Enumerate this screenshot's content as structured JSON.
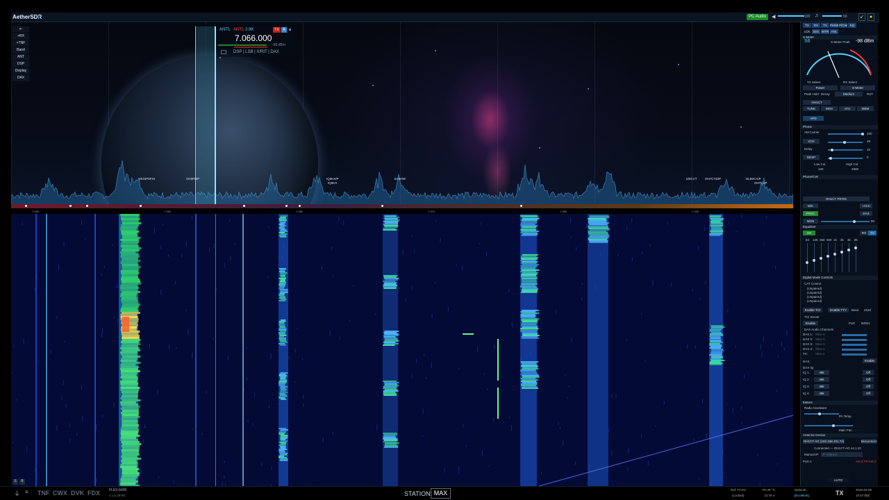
{
  "app": {
    "title": "AetherSDR",
    "slice_label": "Slice A"
  },
  "top": {
    "pc_audio": "PC Audio",
    "vol1": "100",
    "vol2": "50"
  },
  "left_tools": [
    "⇤",
    "+RX",
    "+TNF",
    "Band",
    "ANT",
    "DSP",
    "Display",
    "DAX"
  ],
  "slice": {
    "ant1": "ANT1",
    "ant2": "ANT1",
    "bw": "2.9K",
    "tx": "TX",
    "letter": "A",
    "frequency": "7.066.000",
    "dbm": "-98 dBm",
    "tabs": "DSP  |  LSB  |  X/RIT  |  DAX"
  },
  "spots": [
    {
      "text": "VK/SP6FIH"
    },
    {
      "text": "OH3FB/P"
    },
    {
      "text": "IQ0KX/P"
    },
    {
      "text": "IQ0KX"
    },
    {
      "text": "EA9HW"
    },
    {
      "text": "IZ0CVT"
    },
    {
      "text": "OH7CYD/P"
    },
    {
      "text": "DL8SCA/P"
    },
    {
      "text": "OH7CVP"
    }
  ],
  "scale": [
    "7.040",
    "7.050",
    "7.060",
    "7.070",
    "7.080",
    "7.090",
    "7.100"
  ],
  "right": {
    "tabs": [
      "TX",
      "RX",
      "TX",
      "PHNE",
      "P/CW",
      "EQ"
    ],
    "tabs2": [
      "LCK",
      "DIG",
      "WTR",
      "ANL"
    ],
    "smeter_title": "S-Meter",
    "s_value": "S6",
    "dbm_value": "-98 dBm",
    "smeter_caption": "S-Meter Peak",
    "tx_select": "TX Select",
    "rx_select": "RX Select",
    "power": "Power",
    "smeter": "S-Meter",
    "peak_hold": "Peak Hold",
    "decay": "Decay",
    "medium": "Medium",
    "rst": "RST",
    "callsign_select": "OH1CT",
    "tune": "TUNE",
    "mox": "MOX",
    "atu": "ATU",
    "mem": "MEM",
    "apd": "APD",
    "phone_head": "Phone",
    "am_carrier": "AM Carrier",
    "am_val": "100",
    "vox": "VOX",
    "vox_val": "49",
    "delay": "Delay",
    "delay_val": "16",
    "dexp": "DEXP",
    "dexp_val": "0",
    "lowcut": "Low Cut",
    "highcut": "High Cut",
    "tx_lo": "100",
    "tx_hi": "2900",
    "phonecw_head": "Phone/CW",
    "profile": "OH1CT PR781",
    "mic": "MIC",
    "acc": "+ACC",
    "proc": "PROC",
    "dax": "DAX",
    "mon": "MON",
    "mon_val": "80",
    "eq_head": "Equalizer",
    "eq_on": "ON",
    "eq_rx": "RX",
    "eq_tx": "TX",
    "eq_freqs": [
      "63",
      "125",
      "250",
      "500",
      "1k",
      "2k",
      "4k",
      "8k"
    ],
    "digital_head": "Digital Mode Controls",
    "cat_control": "CAT Control",
    "cat_rows": [
      "(Unpaired)",
      "(Unpaired)",
      "(Unpaired)",
      "(Unpaired)"
    ],
    "enable_tci": "Enable TCI",
    "enable_tty": "Enable TTY",
    "base": "Base:",
    "base_val": "4532",
    "tci_server": "TCI Server",
    "enable": "Enable",
    "port": "Port:",
    "port_val": "50001",
    "dax_audio": "DAX Audio Channels",
    "dax_rows": [
      "DAX 1:",
      "DAX 2:",
      "DAX 3:",
      "DAX 4:",
      "TX:"
    ],
    "dax_slice": "Slice A",
    "dax_label": "DAX:",
    "dax_enable": "Enable",
    "daxiq_head": "DAX IQ",
    "iq_rows": [
      "IQ 1:",
      "IQ 2:",
      "IQ 3:",
      "IQ 4:"
    ],
    "iq_rate": "48k",
    "iq_off": "Off",
    "meters_head": "Meters",
    "radio_hw": "Radio Hardware",
    "pa_temp": "PA Temp",
    "main_fan": "Main Fan",
    "antenna_genius": "Antenna Genius",
    "ag_ip": "OH1CT-AG (192.168.101.72)",
    "disconnect": "Disconnect",
    "connected": "Connected — OH1CT-AG v4.1.10",
    "manual_ip": "Manual IP:",
    "ip_placeholder": "IP Address",
    "port_a": "Port A:",
    "ant_map": "Ant 2  TX:Ant 2",
    "auto": "AUTO"
  },
  "bottom": {
    "tnf": "TNF",
    "cwx": "CWX",
    "dvk": "DVK",
    "fdx": "FDX",
    "model": "FLEX-6400",
    "version": "4.1.5.39794",
    "station_label": "STATION:",
    "station_value": "MAX",
    "ref": "Ref: TCXO",
    "ref_sub": "(Locked)",
    "pa": "PA 26 °C",
    "pa_sub": "13.76 V",
    "network": "Network:",
    "network_sub": "[Excellent]",
    "tx": "TX",
    "date": "2026-04-05",
    "time": "10:07:58Z"
  },
  "colors": {
    "accent": "#5ad0ff",
    "tx_red": "#c51e1e",
    "green": "#1f8a2a",
    "bg": "#000000"
  }
}
